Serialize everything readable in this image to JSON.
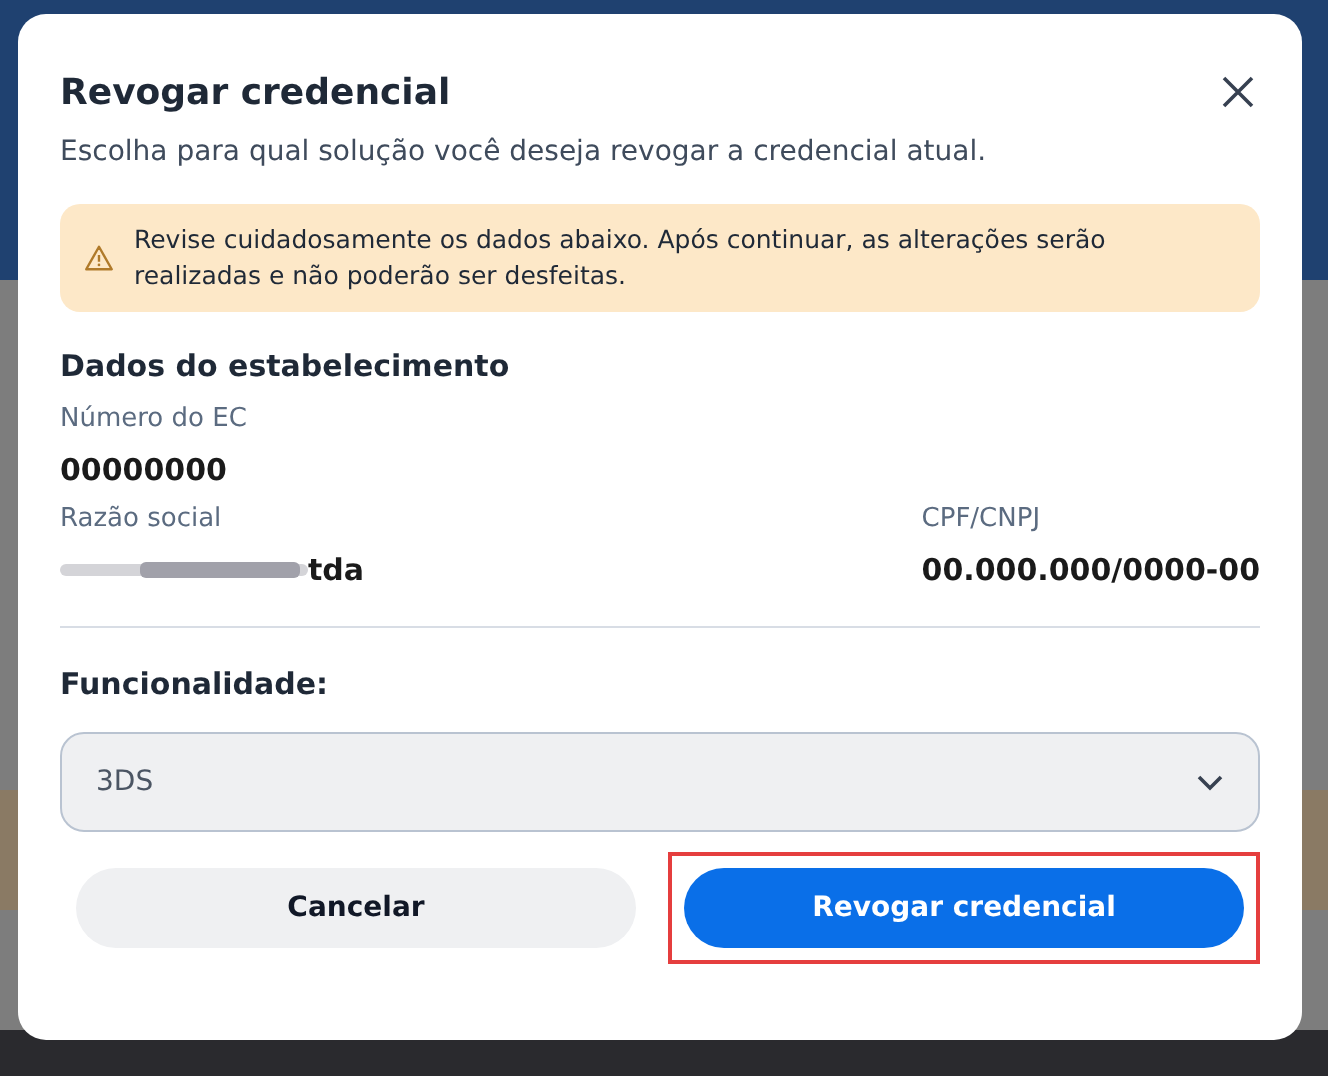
{
  "dialog": {
    "title": "Revogar credencial",
    "subtitle": "Escolha para qual solução você deseja revogar a credencial atual."
  },
  "alert": {
    "text": "Revise cuidadosamente os dados abaixo. Após continuar, as alterações serão realizadas e não poderão ser desfeitas."
  },
  "section": {
    "title": "Dados do estabelecimento",
    "fields": [
      {
        "label": "Número do EC",
        "value": "00000000"
      },
      {
        "label": "Razão social",
        "value": "tda",
        "redacted": true
      },
      {
        "label": "CPF/CNPJ",
        "value": "00.000.000/0000-00"
      }
    ]
  },
  "select": {
    "label": "Funcionalidade:",
    "value": "3DS"
  },
  "buttons": [
    {
      "label": "Cancelar",
      "kind": "secondary",
      "highlighted": false
    },
    {
      "label": "Revogar credencial",
      "kind": "primary",
      "highlighted": true
    }
  ]
}
